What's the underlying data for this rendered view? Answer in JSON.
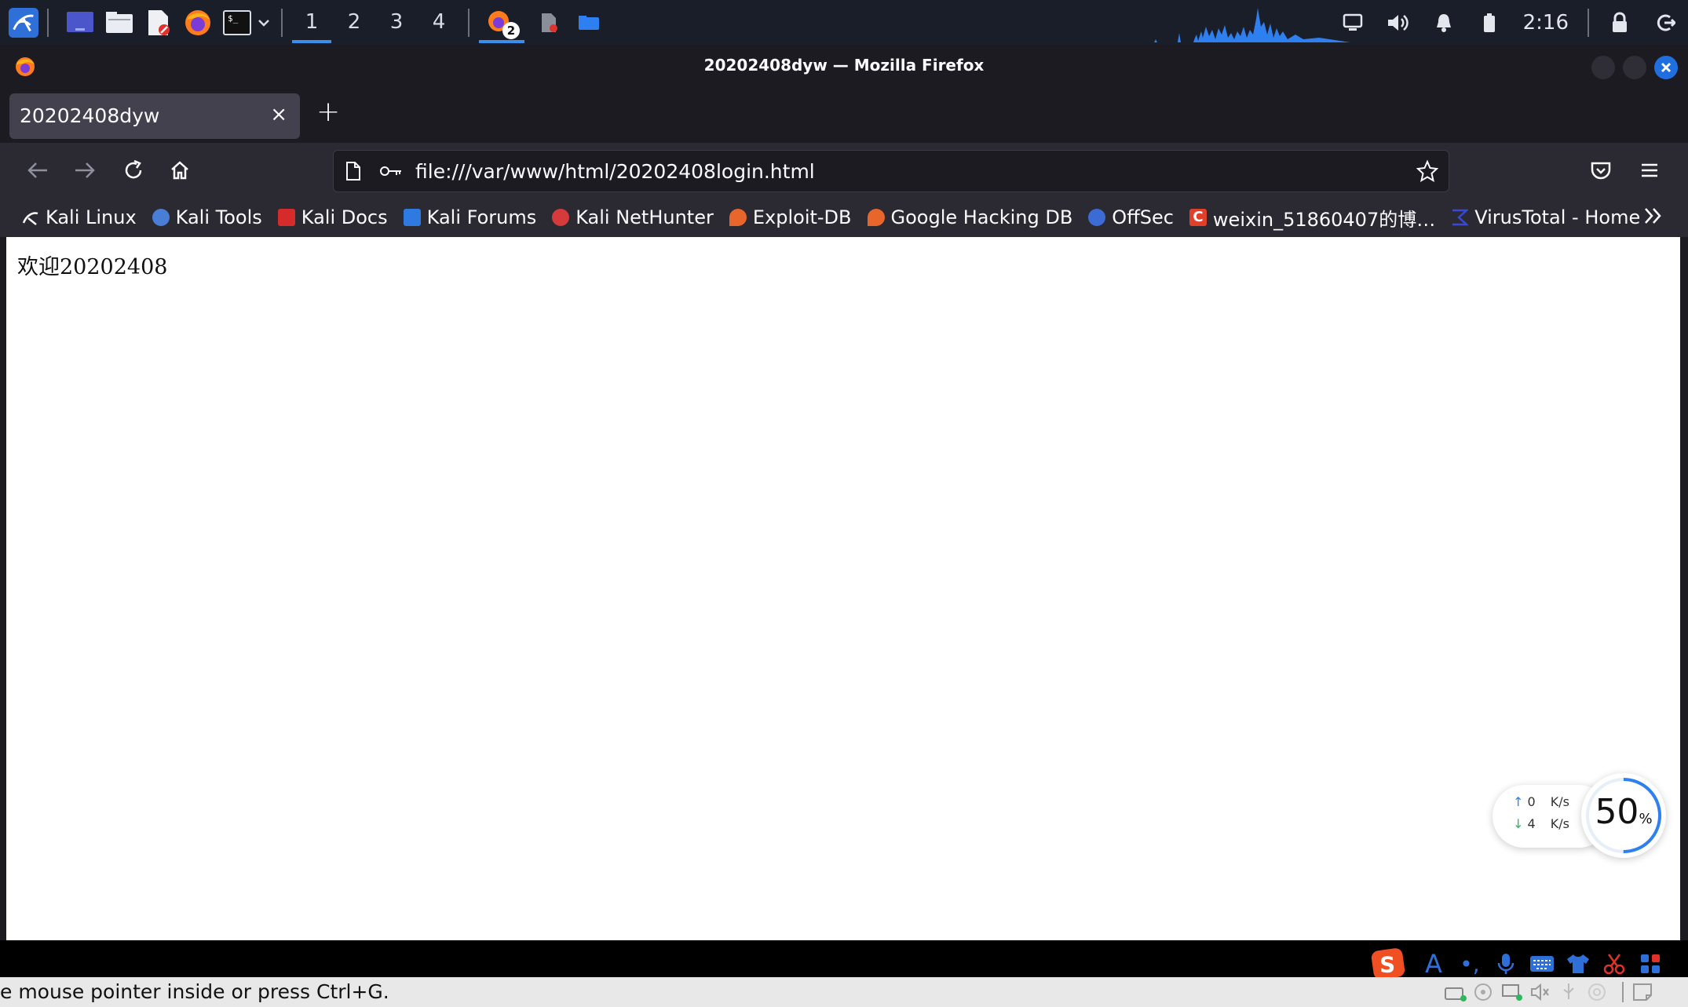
{
  "taskbar": {
    "workspaces": [
      "1",
      "2",
      "3",
      "4"
    ],
    "active_workspace": "1",
    "firefox_badge": "2",
    "clock": "2:16"
  },
  "window": {
    "title": "20202408dyw — Mozilla Firefox"
  },
  "tabs": [
    {
      "label": "20202408dyw",
      "close": "×"
    }
  ],
  "new_tab": "+",
  "url": "file:///var/www/html/20202408login.html",
  "bookmarks": [
    {
      "label": "Kali Linux",
      "color": "#ffffff"
    },
    {
      "label": "Kali Tools",
      "color": "#4a7dd6"
    },
    {
      "label": "Kali Docs",
      "color": "#d62b2b"
    },
    {
      "label": "Kali Forums",
      "color": "#2f7ae0"
    },
    {
      "label": "Kali NetHunter",
      "color": "#d63a3a"
    },
    {
      "label": "Exploit-DB",
      "color": "#e8652b"
    },
    {
      "label": "Google Hacking DB",
      "color": "#e8652b"
    },
    {
      "label": "OffSec",
      "color": "#3c6bd6"
    },
    {
      "label": "weixin_51860407的博…",
      "color": "#e0402a"
    },
    {
      "label": "VirusTotal - Home",
      "color": "#3a48d6"
    }
  ],
  "page": {
    "welcome_text": "欢迎20202408"
  },
  "network_widget": {
    "upload": "0",
    "download": "4",
    "unit": "K/s",
    "percent": "50",
    "percent_sign": "%",
    "percent_value": 50
  },
  "statusbar": {
    "text": "e mouse pointer inside or press Ctrl+G."
  }
}
